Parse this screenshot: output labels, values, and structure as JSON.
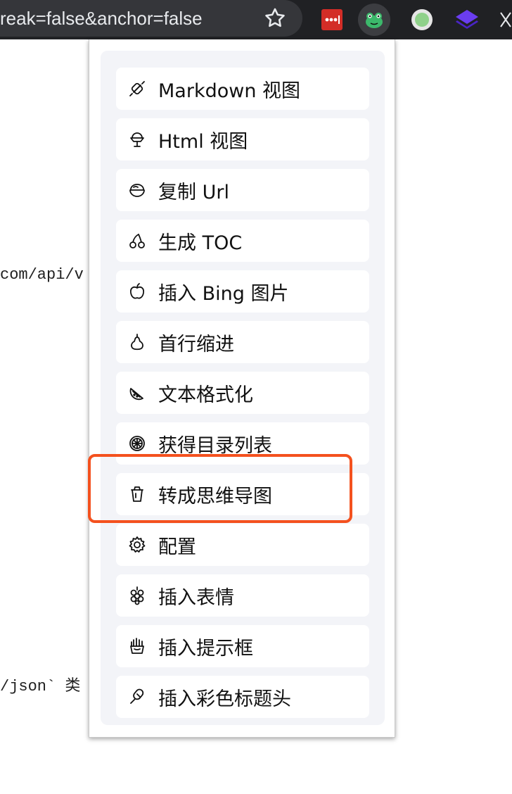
{
  "browser": {
    "url_fragment": "reak=false&anchor=false",
    "extensions": [
      "lastpass-icon",
      "frog-extension-icon",
      "circle-extension-icon",
      "layers-extension-icon",
      "scissors-icon"
    ]
  },
  "background_page": {
    "line1": "com/api/v",
    "line2": "/json` 类"
  },
  "menu": {
    "items": [
      {
        "label": "Markdown 视图",
        "icon": "candy-icon"
      },
      {
        "label": "Html 视图",
        "icon": "ice-cream-icon"
      },
      {
        "label": "复制 Url",
        "icon": "bowl-icon"
      },
      {
        "label": "生成 TOC",
        "icon": "cherries-icon"
      },
      {
        "label": "插入 Bing 图片",
        "icon": "apple-icon"
      },
      {
        "label": "首行缩进",
        "icon": "pear-icon"
      },
      {
        "label": "文本格式化",
        "icon": "watermelon-slice-icon"
      },
      {
        "label": "获得目录列表",
        "icon": "orange-slice-icon"
      },
      {
        "label": "转成思维导图",
        "icon": "cup-icon"
      },
      {
        "label": "配置",
        "icon": "gear-icon"
      },
      {
        "label": "插入表情",
        "icon": "grapes-icon"
      },
      {
        "label": "插入提示框",
        "icon": "fries-icon"
      },
      {
        "label": "插入彩色标题头",
        "icon": "popsicle-icon"
      }
    ]
  },
  "colors": {
    "highlight": "#f4511e",
    "panel_bg": "#f3f4f8",
    "toolbar_bg": "#202124"
  }
}
